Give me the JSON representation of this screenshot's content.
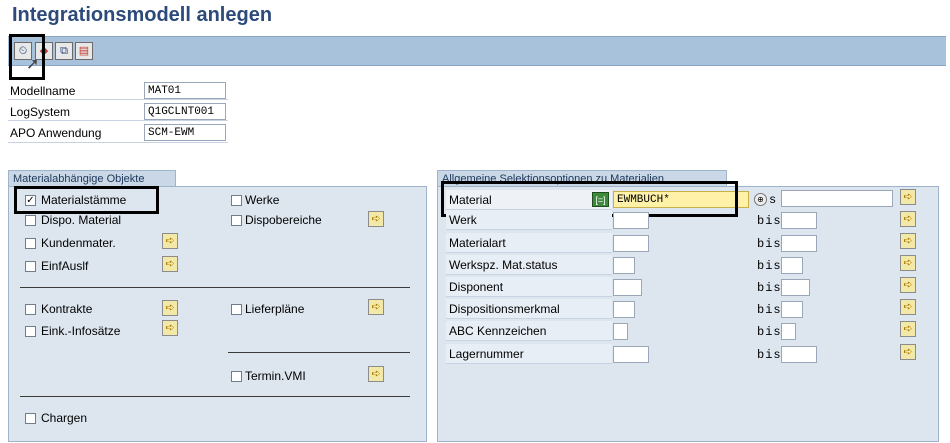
{
  "title": "Integrationsmodell anlegen",
  "toolbar": {
    "execute_icon": "clock-execute-icon",
    "variant_icon": "variant-icon",
    "copy_icon": "copy-icon",
    "delete_icon": "delete-icon"
  },
  "header_fields": {
    "modellname_label": "Modellname",
    "modellname_value": "MAT01",
    "logsystem_label": "LogSystem",
    "logsystem_value": "Q1GCLNT001",
    "apo_label": "APO Anwendung",
    "apo_value": "SCM-EWM"
  },
  "left_panel": {
    "title": "Materialabhängige Objekte",
    "items": {
      "materialstamme": {
        "label": "Materialstämme",
        "checked": true
      },
      "werke": {
        "label": "Werke",
        "checked": false
      },
      "dispo_material": {
        "label": "Dispo. Material",
        "checked": false
      },
      "dispobereiche": {
        "label": "Dispobereiche",
        "checked": false
      },
      "kundenmater": {
        "label": "Kundenmater.",
        "checked": false
      },
      "einfauslf": {
        "label": "EinfAuslf",
        "checked": false
      },
      "kontrakte": {
        "label": "Kontrakte",
        "checked": false
      },
      "lieferplane": {
        "label": "Lieferpläne",
        "checked": false
      },
      "eink_infosatze": {
        "label": "Eink.-Infosätze",
        "checked": false
      },
      "termin_vmi": {
        "label": "Termin.VMI",
        "checked": false
      },
      "chargen": {
        "label": "Chargen",
        "checked": false
      }
    }
  },
  "right_panel": {
    "title": "Allgemeine Selektionsoptionen zu Materialien",
    "rows": [
      {
        "label": "Material",
        "from": "EWMBUCH*",
        "to_label": "s",
        "to": ""
      },
      {
        "label": "Werk",
        "from": "",
        "to_label": "bis",
        "to": ""
      },
      {
        "label": "Materialart",
        "from": "",
        "to_label": "bis",
        "to": ""
      },
      {
        "label": "Werkspz. Mat.status",
        "from": "",
        "to_label": "bis",
        "to": ""
      },
      {
        "label": "Disponent",
        "from": "",
        "to_label": "bis",
        "to": ""
      },
      {
        "label": "Dispositionsmerkmal",
        "from": "",
        "to_label": "bis",
        "to": ""
      },
      {
        "label": "ABC Kennzeichen",
        "from": "",
        "to_label": "bis",
        "to": ""
      },
      {
        "label": "Lagernummer",
        "from": "",
        "to_label": "bis",
        "to": ""
      }
    ]
  },
  "icons": {
    "multiple_selection": "arrow-right-icon",
    "checkmark": "✓"
  }
}
